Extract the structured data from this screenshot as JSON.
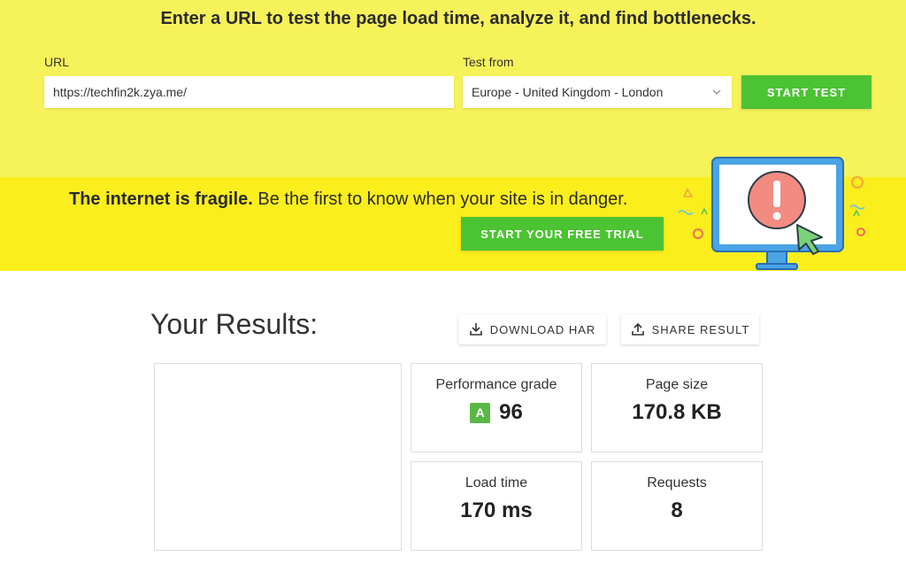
{
  "header": {
    "title": "Enter a URL to test the page load time, analyze it, and find bottlenecks."
  },
  "form": {
    "url_label": "URL",
    "url_value": "https://techfin2k.zya.me/",
    "location_label": "Test from",
    "location_selected": "Europe - United Kingdom - London",
    "start_label": "START TEST"
  },
  "promo": {
    "bold": "The internet is fragile.",
    "text": " Be the first to know when your site is in danger.",
    "cta_label": "START YOUR FREE TRIAL"
  },
  "results": {
    "title": "Your Results:",
    "download_label": "DOWNLOAD HAR",
    "share_label": "SHARE RESULT",
    "grade_label": "Performance grade",
    "grade_letter": "A",
    "grade_value": "96",
    "size_label": "Page size",
    "size_value": "170.8 KB",
    "load_label": "Load time",
    "load_value": "170 ms",
    "requests_label": "Requests",
    "requests_value": "8"
  },
  "colors": {
    "top_bg": "#f6f25a",
    "promo_bg": "#fbee1d",
    "green": "#4cc333",
    "grade_badge": "#5bb846"
  },
  "icons": {
    "chevron": "chevron-down-icon",
    "download": "download-icon",
    "share": "share-icon",
    "illustration": "monitor-alert-illustration"
  }
}
